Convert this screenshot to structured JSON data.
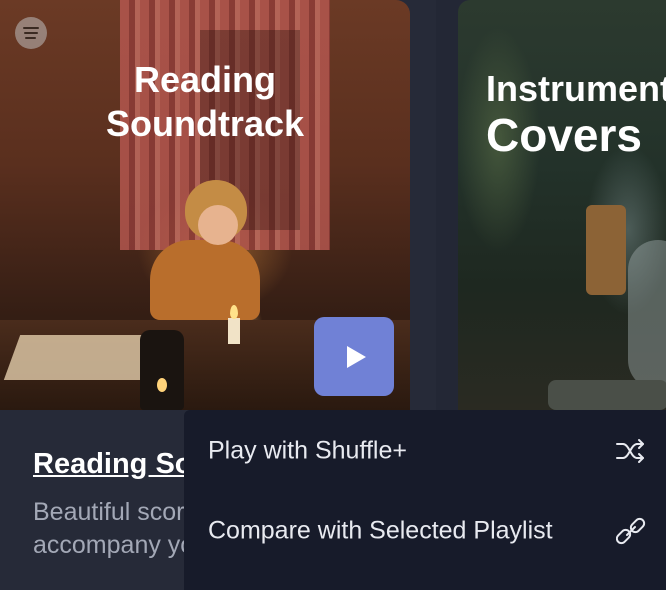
{
  "playlists": [
    {
      "cover_lines": [
        "Reading",
        "Soundtrack"
      ],
      "title": "Reading Soundtrack",
      "description_lines": [
        "Beautiful scores to",
        "accompany your reading."
      ]
    },
    {
      "cover_lines": [
        "Instrumental",
        "Covers"
      ]
    }
  ],
  "context_menu": {
    "items": [
      {
        "label": "Play with Shuffle+",
        "icon": "shuffle-icon"
      },
      {
        "label": "Compare with Selected Playlist",
        "icon": "link-icon"
      }
    ]
  },
  "colors": {
    "background": "#232735",
    "menu_background": "#171b2a",
    "play_button": "#7081d6",
    "description_text": "#a3a8b6"
  },
  "icons": {
    "cover_logo": "spotify-logo-icon",
    "play": "play-icon"
  }
}
